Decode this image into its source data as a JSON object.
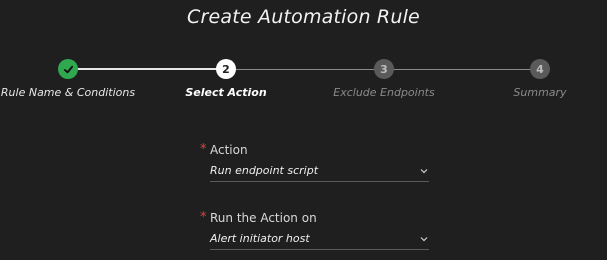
{
  "title": "Create Automation Rule",
  "steps": [
    {
      "number": "1",
      "label": "Rule Name & Conditions",
      "state": "completed"
    },
    {
      "number": "2",
      "label": "Select Action",
      "state": "active"
    },
    {
      "number": "3",
      "label": "Exclude Endpoints",
      "state": "pending"
    },
    {
      "number": "4",
      "label": "Summary",
      "state": "pending"
    }
  ],
  "form": {
    "action": {
      "required_mark": "*",
      "label": "Action",
      "value": "Run endpoint script"
    },
    "run_on": {
      "required_mark": "*",
      "label": "Run the Action on",
      "value": "Alert initiator host"
    }
  },
  "icons": {
    "completed": "check-icon",
    "dropdown": "chevron-down-icon"
  },
  "colors": {
    "background": "#1f1f1f",
    "completed": "#2fa84f",
    "active": "#ffffff",
    "pending": "#5a5a5a",
    "required": "#e0453a"
  }
}
